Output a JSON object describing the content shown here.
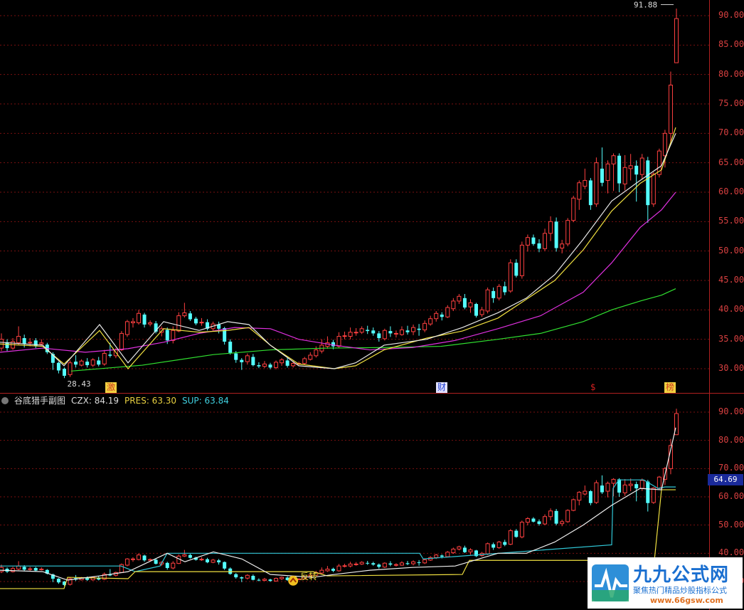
{
  "main": {
    "ticks": [
      "90.00",
      "85.00",
      "80.00",
      "75.00",
      "70.00",
      "65.00",
      "60.00",
      "55.00",
      "50.00",
      "45.00",
      "40.00",
      "35.00",
      "30.00"
    ],
    "high_label": "91.88",
    "low_label": "28.43",
    "events": [
      {
        "label": "激",
        "color": "#d04020",
        "bg": "#f0d040"
      },
      {
        "label": "财",
        "color": "#2040d0",
        "bg": "#e0e0ff"
      },
      {
        "label": "$",
        "color": "#d02020",
        "bg": "transparent"
      },
      {
        "label": "榜",
        "color": "#d04020",
        "bg": "#f0d040"
      }
    ]
  },
  "sub": {
    "title": "谷底猎手副图",
    "czx_label": "CZX: 84.19",
    "pres_label": "PRES: 63.30",
    "sup_label": "SUP: 63.84",
    "ticks": [
      "90.00",
      "80.00",
      "70.00",
      "60.00",
      "50.00",
      "40.00",
      "30.00"
    ],
    "price_badge": "64.69",
    "signal_label": "反转"
  },
  "logo": {
    "brand": "九九公式网",
    "slogan": "聚焦热门精品炒股指标公式",
    "url": "www.66gsw.com"
  },
  "chart_data": {
    "type": "candlestick",
    "ylim_main": [
      27,
      93
    ],
    "ylim_sub": [
      27,
      93
    ],
    "candles": [
      [
        33.5,
        35.0,
        36.0,
        33.0
      ],
      [
        34.5,
        33.5,
        35.0,
        33.0
      ],
      [
        33.5,
        34.6,
        35.2,
        33.2
      ],
      [
        34.4,
        35.5,
        37.2,
        34.0
      ],
      [
        35.2,
        34.2,
        35.8,
        33.6
      ],
      [
        34.4,
        34.5,
        35.2,
        33.8
      ],
      [
        34.8,
        33.9,
        35.2,
        33.5
      ],
      [
        34.2,
        34.4,
        35.0,
        33.9
      ],
      [
        34.1,
        32.8,
        34.4,
        32.5
      ],
      [
        32.5,
        31.0,
        32.8,
        29.8
      ],
      [
        31.0,
        29.7,
        31.2,
        29.2
      ],
      [
        30.0,
        28.8,
        30.2,
        28.4
      ],
      [
        29.0,
        31.0,
        31.4,
        28.6
      ],
      [
        31.2,
        30.7,
        32.3,
        30.2
      ],
      [
        30.6,
        31.3,
        31.6,
        30.4
      ],
      [
        31.2,
        30.6,
        31.8,
        30.2
      ],
      [
        30.6,
        31.5,
        31.8,
        30.3
      ],
      [
        31.4,
        30.7,
        32.0,
        30.4
      ],
      [
        30.8,
        32.6,
        33.2,
        30.5
      ],
      [
        32.4,
        32.2,
        34.4,
        31.9
      ],
      [
        32.2,
        33.2,
        33.5,
        31.8
      ],
      [
        33.2,
        36.0,
        36.4,
        33.0
      ],
      [
        35.8,
        38.0,
        38.3,
        35.4
      ],
      [
        37.8,
        38.0,
        38.6,
        37.0
      ],
      [
        37.8,
        39.4,
        40.0,
        37.5
      ],
      [
        39.2,
        37.5,
        39.5,
        37.0
      ],
      [
        37.6,
        37.8,
        38.2,
        37.2
      ],
      [
        37.7,
        36.3,
        38.1,
        36.0
      ],
      [
        36.2,
        36.8,
        37.2,
        35.5
      ],
      [
        36.6,
        34.8,
        37.0,
        34.2
      ],
      [
        34.8,
        36.5,
        37.2,
        34.3
      ],
      [
        36.4,
        39.0,
        39.6,
        36.2
      ],
      [
        39.0,
        39.5,
        41.2,
        38.7
      ],
      [
        39.4,
        38.4,
        39.8,
        38.1
      ],
      [
        38.5,
        37.7,
        38.8,
        37.4
      ],
      [
        37.8,
        37.9,
        38.6,
        37.3
      ],
      [
        37.9,
        36.8,
        38.4,
        36.5
      ],
      [
        36.8,
        37.6,
        38.0,
        36.5
      ],
      [
        37.5,
        36.8,
        38.0,
        36.0
      ],
      [
        36.9,
        34.6,
        37.1,
        34.1
      ],
      [
        34.6,
        32.7,
        35.0,
        32.4
      ],
      [
        32.6,
        31.5,
        33.0,
        31.0
      ],
      [
        31.5,
        31.1,
        31.8,
        29.8
      ],
      [
        31.2,
        32.2,
        32.6,
        30.7
      ],
      [
        32.0,
        30.6,
        32.5,
        30.4
      ],
      [
        30.6,
        30.4,
        31.1,
        30.1
      ],
      [
        30.4,
        30.8,
        31.3,
        30.1
      ],
      [
        30.7,
        30.2,
        31.0,
        29.9
      ],
      [
        30.2,
        31.1,
        31.4,
        29.9
      ],
      [
        31.0,
        31.5,
        31.8,
        30.5
      ],
      [
        31.4,
        30.5,
        31.8,
        30.2
      ],
      [
        30.5,
        30.9,
        31.3,
        30.2
      ],
      [
        30.9,
        30.9,
        31.2,
        30.6
      ],
      [
        30.9,
        31.7,
        32.0,
        30.7
      ],
      [
        31.6,
        32.3,
        32.8,
        31.4
      ],
      [
        32.2,
        33.2,
        33.8,
        31.9
      ],
      [
        33.0,
        34.0,
        35.0,
        32.6
      ],
      [
        33.8,
        34.4,
        35.5,
        33.4
      ],
      [
        34.5,
        33.8,
        34.9,
        33.3
      ],
      [
        33.8,
        35.5,
        36.2,
        33.5
      ],
      [
        35.5,
        35.6,
        36.3,
        35.0
      ],
      [
        35.5,
        36.2,
        37.0,
        35.0
      ],
      [
        36.2,
        36.2,
        36.9,
        35.6
      ],
      [
        36.2,
        36.8,
        37.2,
        35.9
      ],
      [
        36.6,
        36.4,
        37.3,
        35.9
      ],
      [
        36.5,
        36.0,
        37.0,
        35.6
      ],
      [
        36.0,
        35.2,
        36.4,
        34.6
      ],
      [
        35.1,
        36.5,
        36.8,
        34.8
      ],
      [
        36.4,
        36.0,
        37.2,
        35.4
      ],
      [
        36.0,
        36.0,
        36.5,
        35.3
      ],
      [
        35.8,
        36.6,
        37.2,
        35.6
      ],
      [
        36.5,
        36.2,
        37.3,
        35.8
      ],
      [
        36.3,
        37.0,
        37.5,
        35.7
      ],
      [
        36.8,
        36.6,
        37.6,
        35.6
      ],
      [
        36.6,
        37.7,
        38.2,
        36.2
      ],
      [
        37.6,
        38.5,
        39.0,
        37.3
      ],
      [
        38.5,
        39.4,
        39.8,
        38.0
      ],
      [
        39.2,
        38.8,
        39.6,
        38.2
      ],
      [
        38.8,
        40.4,
        40.8,
        38.6
      ],
      [
        40.2,
        41.5,
        42.0,
        39.8
      ],
      [
        41.5,
        42.3,
        42.7,
        41.0
      ],
      [
        42.0,
        40.4,
        42.7,
        40.1
      ],
      [
        40.5,
        41.2,
        41.8,
        39.5
      ],
      [
        41.0,
        39.0,
        41.2,
        38.7
      ],
      [
        39.2,
        40.0,
        40.5,
        38.8
      ],
      [
        39.8,
        43.4,
        43.8,
        39.4
      ],
      [
        43.2,
        42.0,
        43.8,
        41.2
      ],
      [
        42.0,
        44.0,
        44.4,
        41.6
      ],
      [
        44.0,
        43.0,
        44.8,
        42.5
      ],
      [
        43.2,
        48.0,
        48.6,
        42.9
      ],
      [
        48.0,
        45.8,
        48.6,
        45.5
      ],
      [
        45.8,
        51.0,
        51.6,
        45.3
      ],
      [
        51.0,
        52.3,
        52.8,
        49.9
      ],
      [
        52.3,
        51.2,
        52.8,
        50.9
      ],
      [
        51.3,
        50.4,
        52.0,
        49.8
      ],
      [
        50.4,
        53.0,
        53.8,
        50.0
      ],
      [
        53.0,
        55.0,
        55.9,
        51.7
      ],
      [
        55.0,
        50.5,
        55.7,
        49.9
      ],
      [
        50.5,
        51.2,
        51.9,
        49.6
      ],
      [
        51.2,
        55.2,
        55.6,
        50.8
      ],
      [
        55.2,
        59.0,
        59.4,
        54.9
      ],
      [
        58.8,
        61.6,
        62.0,
        57.0
      ],
      [
        61.0,
        62.0,
        64.0,
        60.5
      ],
      [
        62.0,
        57.8,
        62.4,
        57.0
      ],
      [
        58.0,
        65.0,
        65.9,
        57.5
      ],
      [
        64.0,
        61.6,
        67.6,
        61.0
      ],
      [
        62.0,
        64.8,
        65.4,
        59.8
      ],
      [
        64.8,
        66.2,
        66.6,
        60.2
      ],
      [
        66.2,
        61.5,
        66.6,
        60.0
      ],
      [
        61.4,
        64.2,
        66.3,
        60.3
      ],
      [
        64.0,
        64.5,
        66.5,
        62.0
      ],
      [
        64.5,
        63.0,
        65.4,
        58.4
      ],
      [
        63.0,
        65.8,
        66.5,
        62.1
      ],
      [
        65.4,
        57.8,
        66.0,
        54.8
      ],
      [
        58.0,
        63.1,
        63.4,
        57.5
      ],
      [
        63.0,
        67.0,
        67.4,
        62.5
      ],
      [
        66.2,
        70.0,
        70.6,
        64.2
      ],
      [
        70.0,
        78.2,
        80.5,
        68.0
      ],
      [
        82.0,
        89.5,
        91.2,
        82.0
      ]
    ],
    "ma_yellow": [
      [
        0,
        34.2
      ],
      [
        60,
        33.8
      ],
      [
        90,
        30.8
      ],
      [
        140,
        36.5
      ],
      [
        180,
        30.0
      ],
      [
        230,
        36.8
      ],
      [
        280,
        36.2
      ],
      [
        320,
        36.5
      ],
      [
        350,
        37.0
      ],
      [
        380,
        34.0
      ],
      [
        420,
        30.8
      ],
      [
        470,
        30.0
      ],
      [
        500,
        30.5
      ],
      [
        540,
        33.2
      ],
      [
        600,
        35.2
      ],
      [
        650,
        36.4
      ],
      [
        700,
        38.6
      ],
      [
        740,
        41.8
      ],
      [
        780,
        45.0
      ],
      [
        820,
        50.2
      ],
      [
        860,
        56.8
      ],
      [
        900,
        61.5
      ],
      [
        930,
        63.8
      ],
      [
        950,
        71.0
      ]
    ],
    "ma_white": [
      [
        0,
        34.5
      ],
      [
        60,
        34.0
      ],
      [
        90,
        30.5
      ],
      [
        140,
        37.5
      ],
      [
        180,
        31.0
      ],
      [
        230,
        38.0
      ],
      [
        280,
        36.5
      ],
      [
        320,
        38.0
      ],
      [
        350,
        37.5
      ],
      [
        380,
        34.0
      ],
      [
        420,
        30.5
      ],
      [
        470,
        30.0
      ],
      [
        500,
        31.0
      ],
      [
        540,
        34.0
      ],
      [
        600,
        35.0
      ],
      [
        650,
        37.0
      ],
      [
        700,
        39.5
      ],
      [
        740,
        42.0
      ],
      [
        780,
        46.0
      ],
      [
        820,
        52.0
      ],
      [
        860,
        58.5
      ],
      [
        900,
        62.0
      ],
      [
        930,
        64.5
      ],
      [
        950,
        70.0
      ]
    ],
    "ma_magenta": [
      [
        0,
        32.8
      ],
      [
        60,
        33.5
      ],
      [
        120,
        32.8
      ],
      [
        180,
        33.4
      ],
      [
        230,
        34.5
      ],
      [
        280,
        36.0
      ],
      [
        330,
        37.0
      ],
      [
        380,
        36.8
      ],
      [
        420,
        35.0
      ],
      [
        470,
        34.0
      ],
      [
        520,
        33.2
      ],
      [
        580,
        33.6
      ],
      [
        640,
        34.8
      ],
      [
        700,
        36.8
      ],
      [
        760,
        39.0
      ],
      [
        820,
        43.0
      ],
      [
        860,
        48.0
      ],
      [
        900,
        54.0
      ],
      [
        930,
        57.0
      ],
      [
        950,
        60.0
      ]
    ],
    "ma_green": [
      [
        100,
        29.6
      ],
      [
        200,
        30.6
      ],
      [
        300,
        32.4
      ],
      [
        380,
        33.2
      ],
      [
        460,
        33.5
      ],
      [
        540,
        33.6
      ],
      [
        620,
        33.8
      ],
      [
        700,
        35.0
      ],
      [
        760,
        36.0
      ],
      [
        820,
        38.0
      ],
      [
        860,
        40.0
      ],
      [
        900,
        41.5
      ],
      [
        930,
        42.5
      ],
      [
        950,
        43.6
      ]
    ],
    "sub_cyan": [
      [
        0,
        35.5
      ],
      [
        170,
        35.5
      ],
      [
        190,
        33.5
      ],
      [
        225,
        35.5
      ],
      [
        235,
        40.0
      ],
      [
        300,
        40.0
      ],
      [
        310,
        40.0
      ],
      [
        590,
        40.0
      ],
      [
        595,
        38.0
      ],
      [
        860,
        43.0
      ],
      [
        862,
        63.0
      ],
      [
        870,
        66.0
      ],
      [
        880,
        66.0
      ],
      [
        905,
        66.0
      ],
      [
        925,
        63.0
      ],
      [
        935,
        63.5
      ],
      [
        950,
        63.5
      ]
    ],
    "sub_yellow": [
      [
        0,
        27.5
      ],
      [
        90,
        27.5
      ],
      [
        95,
        31.5
      ],
      [
        180,
        31.0
      ],
      [
        190,
        33.5
      ],
      [
        440,
        33.5
      ],
      [
        460,
        32.0
      ],
      [
        650,
        32.5
      ],
      [
        660,
        37.5
      ],
      [
        920,
        37.5
      ],
      [
        930,
        62.5
      ],
      [
        950,
        62.5
      ]
    ],
    "sub_white": [
      [
        0,
        34.0
      ],
      [
        60,
        33.5
      ],
      [
        95,
        30.5
      ],
      [
        140,
        32.0
      ],
      [
        180,
        33.5
      ],
      [
        235,
        40.0
      ],
      [
        260,
        37.0
      ],
      [
        300,
        40.5
      ],
      [
        340,
        38.0
      ],
      [
        380,
        32.5
      ],
      [
        440,
        31.5
      ],
      [
        470,
        32.5
      ],
      [
        520,
        34.0
      ],
      [
        580,
        35.0
      ],
      [
        640,
        35.5
      ],
      [
        700,
        40.0
      ],
      [
        740,
        40.0
      ],
      [
        780,
        44.0
      ],
      [
        820,
        50.0
      ],
      [
        860,
        57.0
      ],
      [
        900,
        63.0
      ],
      [
        930,
        62.5
      ],
      [
        950,
        84.5
      ]
    ]
  }
}
